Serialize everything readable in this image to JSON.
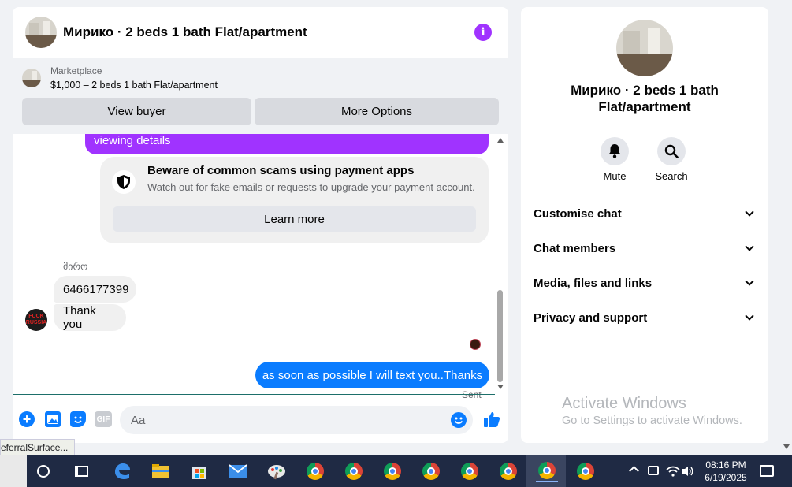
{
  "chat": {
    "title": "Мирико · 2 beds 1 bath Flat/apartment",
    "marketplace": {
      "label": "Marketplace",
      "item": "$1,000 – 2 beds 1 bath Flat/apartment",
      "view_buyer": "View buyer",
      "more_options": "More Options"
    },
    "messages": {
      "outgoing_partial": "viewing details",
      "scam_title": "Beware of common scams using payment apps",
      "scam_sub": "Watch out for fake emails or requests to upgrade your payment account.",
      "learn_more": "Learn more",
      "sender_name": "მირო",
      "incoming_1": "6466177399",
      "incoming_2": "Thank you",
      "avatar_text": "FUCK RUSSIA",
      "outgoing": "as soon as possible I will text you..Thanks",
      "status": "Sent"
    },
    "composer": {
      "placeholder": "Aa",
      "gif": "GIF"
    }
  },
  "sidebar": {
    "title_line1": "Мирико · 2 beds 1 bath",
    "title_line2": "Flat/apartment",
    "mute": "Mute",
    "search": "Search",
    "sections": [
      "Customise chat",
      "Chat members",
      "Media, files and links",
      "Privacy and support"
    ]
  },
  "watermark": {
    "title": "Activate Windows",
    "subtitle": "Go to Settings to activate Windows."
  },
  "status_bar": "eferralSurface...",
  "taskbar": {
    "time": "08:16 PM",
    "date": "6/19/2025"
  },
  "colors": {
    "messenger_purple": "#a033ff",
    "messenger_blue": "#0a7cff",
    "taskbar": "#1f2a44"
  }
}
